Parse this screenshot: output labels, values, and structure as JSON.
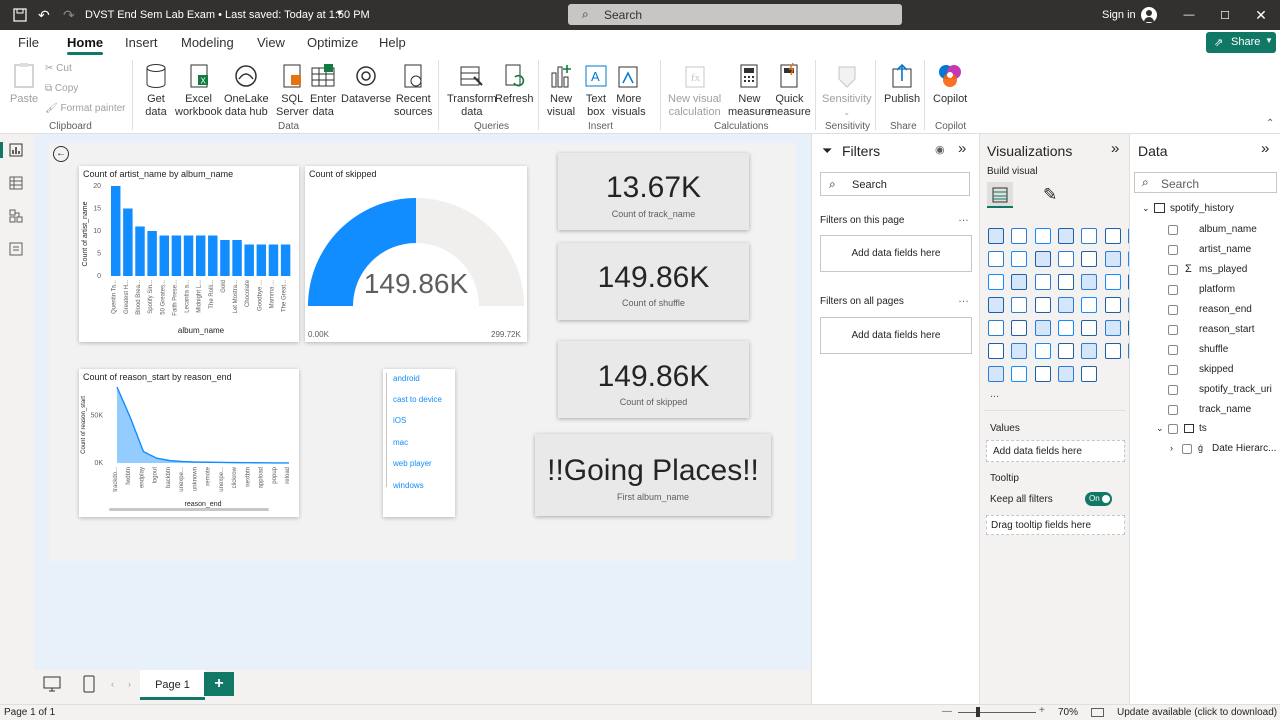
{
  "titlebar": {
    "title": "DVST End Sem Lab Exam • Last saved: Today at 1:50 PM",
    "search_placeholder": "Search",
    "signin": "Sign in"
  },
  "menu": {
    "tabs": [
      "File",
      "Home",
      "Insert",
      "Modeling",
      "View",
      "Optimize",
      "Help"
    ],
    "share": "Share"
  },
  "ribbon": {
    "clipboard": {
      "paste": "Paste",
      "cut": "Cut",
      "copy": "Copy",
      "format_painter": "Format painter",
      "group": "Clipboard"
    },
    "data": {
      "get_data": [
        "Get",
        "data"
      ],
      "excel": [
        "Excel",
        "workbook"
      ],
      "onelake": [
        "OneLake",
        "data hub"
      ],
      "sql": [
        "SQL",
        "Server"
      ],
      "enter": [
        "Enter",
        "data"
      ],
      "dataverse": [
        "Dataverse",
        ""
      ],
      "recent": [
        "Recent",
        "sources"
      ],
      "group": "Data"
    },
    "queries": {
      "transform": [
        "Transform",
        "data"
      ],
      "refresh": [
        "Refresh",
        ""
      ],
      "group": "Queries"
    },
    "insert": {
      "new_visual": [
        "New",
        "visual"
      ],
      "text_box": [
        "Text",
        "box"
      ],
      "more_visuals": [
        "More",
        "visuals"
      ],
      "group": "Insert"
    },
    "calculations": {
      "new_visual_calc": [
        "New visual",
        "calculation"
      ],
      "new_measure": [
        "New",
        "measure"
      ],
      "quick_measure": [
        "Quick",
        "measure"
      ],
      "group": "Calculations"
    },
    "sensitivity": {
      "label": "Sensitivity",
      "group": "Sensitivity"
    },
    "share": {
      "publish": "Publish",
      "group": "Share"
    },
    "copilot": {
      "label": "Copilot",
      "group": "Copilot"
    }
  },
  "report": {
    "bar_visual": {
      "title": "Count of artist_name by album_name",
      "ylabel": "Count of artist_name",
      "xlabel": "album_name"
    },
    "gauge_visual": {
      "title": "Count of skipped",
      "value": "149.86K",
      "min": "0.00K",
      "max": "299.72K",
      "fill_fraction": 0.5
    },
    "line_visual": {
      "title": "Count of reason_start by reason_end",
      "ylabel": "Count of reason_start",
      "xlabel": "reason_end"
    },
    "slicer_items": [
      "android",
      "cast to device",
      "iOS",
      "mac",
      "web player",
      "windows"
    ],
    "cards": [
      {
        "value": "13.67K",
        "label": "Count of track_name"
      },
      {
        "value": "149.86K",
        "label": "Count of shuffle"
      },
      {
        "value": "149.86K",
        "label": "Count of skipped"
      },
      {
        "value": "!!Going Places!!",
        "label": "First album_name"
      }
    ]
  },
  "chart_data": [
    {
      "type": "bar",
      "title": "Count of artist_name by album_name",
      "xlabel": "album_name",
      "ylabel": "Count of artist_name",
      "ylim": [
        0,
        20
      ],
      "yticks": [
        "20",
        "15",
        "10",
        "5",
        "0"
      ],
      "categories": [
        "Quentin Ta...",
        "Greatest H...",
        "Blood Brea...",
        "Spotify Sin...",
        "50 Greates...",
        "Faith Prese...",
        "Lecantia a...",
        "Midnight L...",
        "The Rolli...",
        "Gold",
        "Let Mostra...",
        "Chocolate",
        "Goodbye ...",
        "Mamma ...",
        "The Great..."
      ],
      "values": [
        20,
        15,
        11,
        10,
        9,
        9,
        9,
        9,
        9,
        8,
        8,
        7,
        7,
        7,
        7
      ]
    },
    {
      "type": "area",
      "title": "Count of reason_start by reason_end",
      "xlabel": "reason_end",
      "ylabel": "Count of reason_start",
      "ylim": [
        0,
        80000
      ],
      "yticks": [
        "50K",
        "0K"
      ],
      "categories": [
        "trackdo...",
        "fwdbtn",
        "endplay",
        "logout",
        "backbtn",
        "unexpe...",
        "unknown",
        "remote",
        "unexpe...",
        "clickrow",
        "nextbtn",
        "appload",
        "popup",
        "reload"
      ],
      "values": [
        80000,
        48000,
        12000,
        5000,
        2500,
        1500,
        1000,
        800,
        600,
        400,
        300,
        200,
        100,
        50
      ]
    }
  ],
  "tabs": {
    "page": "Page 1",
    "add": "+"
  },
  "status": {
    "left": "Page 1 of 1",
    "zoom": "70%",
    "update": "Update available (click to download)"
  },
  "filters": {
    "title": "Filters",
    "search": "Search",
    "on_page": "Filters on this page",
    "add_fields_1": "Add data fields here",
    "all_pages": "Filters on all pages",
    "add_fields_2": "Add data fields here"
  },
  "viz": {
    "title": "Visualizations",
    "build": "Build visual",
    "values": "Values",
    "values_add": "Add data fields here",
    "tooltip": "Tooltip",
    "keep_filters": "Keep all filters",
    "toggle": "On",
    "drag_tooltip": "Drag tooltip fields here",
    "more": "..."
  },
  "datapane": {
    "title": "Data",
    "search": "Search",
    "table": "spotify_history",
    "fields": [
      "album_name",
      "artist_name",
      "ms_played",
      "platform",
      "reason_end",
      "reason_start",
      "shuffle",
      "skipped",
      "spotify_track_uri",
      "track_name"
    ],
    "ts": "ts",
    "date_hier": "Date Hierarc..."
  }
}
